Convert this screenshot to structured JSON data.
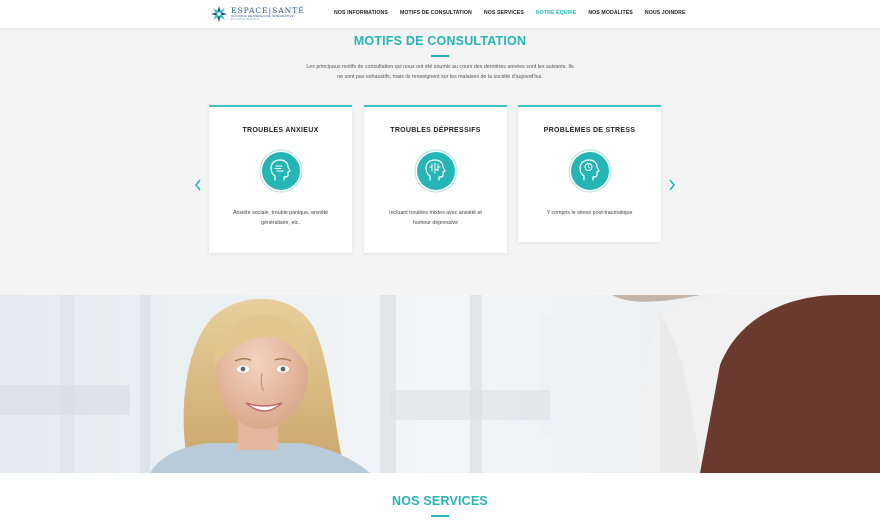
{
  "header": {
    "logo": {
      "name": "ESPACE|SANTÉ",
      "subtitle": "CLINIQUE DE MÉDECINE INTÉGRATIVE",
      "tagline": "EN SANTÉ MENTALE"
    },
    "nav": [
      {
        "label": "NOS INFORMATIONS",
        "active": false
      },
      {
        "label": "MOTIFS DE CONSULTATION",
        "active": false
      },
      {
        "label": "NOS SERVICES",
        "active": false
      },
      {
        "label": "NOTRE ÉQUIPE",
        "active": true
      },
      {
        "label": "NOS MODALITÉS",
        "active": false
      },
      {
        "label": "NOUS JOINDRE",
        "active": false
      }
    ]
  },
  "motifs": {
    "title": "MOTIFS DE CONSULTATION",
    "intro_line1": "Les principaux motifs de consultation qui nous ont été soumis au cours des dernières années sont les suivants. Ils",
    "intro_line2": "ne sont pas exhaustifs, mais ils renseignent sur les malaises de la société d'aujourd'hui.",
    "cards": [
      {
        "title": "TROUBLES ANXIEUX",
        "icon": "head-anxiety-icon",
        "line1": "Anxiété sociale, trouble panique, anxiété",
        "line2": "généralisée, etc."
      },
      {
        "title": "TROUBLES DÉPRESSIFS",
        "icon": "head-brain-icon",
        "line1": "Incluant troubles mixtes avec anxiété et",
        "line2": "humeur dépressive"
      },
      {
        "title": "PROBLÈMES DE STRESS",
        "icon": "head-stress-icon",
        "line1": "Y compris le stress post-traumatique",
        "line2": ""
      }
    ],
    "prev_icon": "chevron-left-icon",
    "next_icon": "chevron-right-icon"
  },
  "services": {
    "title": "NOS SERVICES"
  },
  "colors": {
    "accent": "#26b5b5",
    "brand": "#1f4f86",
    "text": "#333333",
    "background": "#f4f4f4"
  }
}
